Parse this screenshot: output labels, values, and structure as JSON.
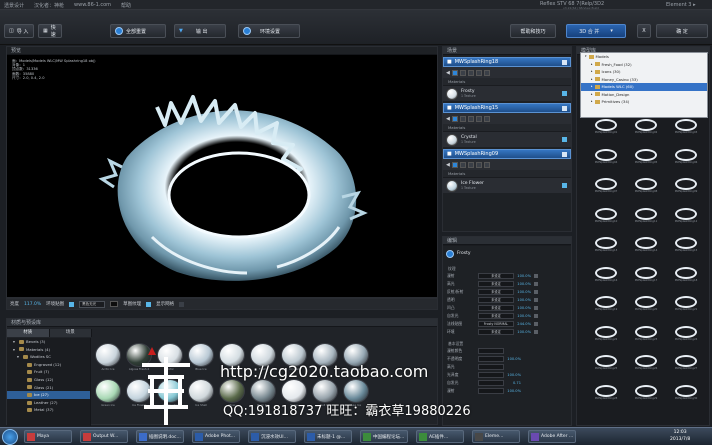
{
  "titlebar": {
    "menus": [
      "透景设计",
      "汉化者：神枪",
      "帮助"
    ],
    "url": "www.86-1.com",
    "window_title": "Reflex STV 68 7(Relp/3D2",
    "window_version": "v3.22(64) SB-View Build",
    "app_label": "Element",
    "app_version": "3 ▸"
  },
  "toolbar": {
    "import": "导 入",
    "quick": "快速",
    "reset_all": "全部重置",
    "export": "输 出",
    "env_settings": "环境设置",
    "help": "帮助和技巧",
    "combine_3d": "3D 合 并",
    "close": "X",
    "confirm": "确  定"
  },
  "viewport": {
    "title": "预览",
    "info": [
      "面：Models/Models WLC/MW Splashring18 obj)",
      "对象：1",
      "顶点数：31336",
      "面数：35880",
      "尺寸：2.0, 0.4, 2.0"
    ]
  },
  "viewport_bar": {
    "brightness_label": "亮度",
    "brightness_value": "117.0%",
    "env_map_label": "环境贴图",
    "env_map_value": "黑色无光",
    "draft_label": "草图纹理",
    "grid_label": "显示网格"
  },
  "library": {
    "title": "材质与预设库",
    "tabs": [
      "材质",
      "场景"
    ],
    "tree": [
      {
        "label": "Bevels (3)",
        "indent": 1,
        "selected": false
      },
      {
        "label": "Materials (4)",
        "indent": 1,
        "selected": false
      },
      {
        "label": "Wodiles SC",
        "indent": 2,
        "selected": false
      },
      {
        "label": "Engraved (12)",
        "indent": 3,
        "selected": false
      },
      {
        "label": "Fruit (7)",
        "indent": 3,
        "selected": false
      },
      {
        "label": "Glass (12)",
        "indent": 3,
        "selected": false
      },
      {
        "label": "Glass (21)",
        "indent": 3,
        "selected": false
      },
      {
        "label": "Ice (27)",
        "indent": 3,
        "selected": true
      },
      {
        "label": "Leather (27)",
        "indent": 3,
        "selected": false
      },
      {
        "label": "Metal (37)",
        "indent": 3,
        "selected": false
      }
    ],
    "thumbs": [
      {
        "label": "Arctic Ice",
        "color": "#c9d4dc"
      },
      {
        "label": "Algoas Fresh 2",
        "color": "#2f3d35"
      },
      {
        "label": "Arctic",
        "color": "#d8dfe4"
      },
      {
        "label": "Blue Ice",
        "color": "#b8c8d4"
      },
      {
        "label": "Frost",
        "color": "#d4dde2"
      },
      {
        "label": "Frosty",
        "color": "#cfd8de"
      },
      {
        "label": "Crystal",
        "color": "#bcc8d0"
      },
      {
        "label": "Cube",
        "color": "#a8b6c0"
      },
      {
        "label": "Glacier",
        "color": "#96a8b4"
      },
      {
        "label": "Green Ice",
        "color": "#a8d8b4"
      },
      {
        "label": "Ice Flower",
        "color": "#c4d4de"
      },
      {
        "label": "Ice Crystal",
        "color": "#86c8d4"
      },
      {
        "label": "Ice Shell",
        "color": "#d0d8dc"
      },
      {
        "label": "Moss",
        "color": "#5a6a4a"
      },
      {
        "label": "Rock Ice",
        "color": "#7a8a92"
      },
      {
        "label": "Snow",
        "color": "#e4e8ec"
      },
      {
        "label": "Dull Ice",
        "color": "#98a4ac"
      },
      {
        "label": "Sea Ice",
        "color": "#6a8a9a"
      }
    ]
  },
  "scene": {
    "title": "场景",
    "objects": [
      {
        "name": "MWSplashRing18",
        "material": "Frosty",
        "mat_sub": "1 Texture",
        "mat_color": "#d6dfe6"
      },
      {
        "name": "MWSplashRing15",
        "material": "Crystal",
        "mat_sub": "1 Texture",
        "mat_color": "#c8d4dc"
      },
      {
        "name": "MWSplashRing09",
        "material": "Ice Flower",
        "mat_sub": "1 Texture",
        "mat_color": "#bcd0dc"
      }
    ],
    "materials_label": "Materials"
  },
  "material_panel": {
    "title": "编辑",
    "name": "Frosty",
    "texture_section": "纹理",
    "rows": [
      {
        "label": "漫射",
        "value": "未设定",
        "num": "100.0%"
      },
      {
        "label": "高光",
        "value": "未设定",
        "num": "100.0%"
      },
      {
        "label": "反射/折射",
        "value": "未设定",
        "num": "100.0%"
      },
      {
        "label": "透明",
        "value": "未设定",
        "num": "100.0%"
      },
      {
        "label": "凹凸",
        "value": "未设定",
        "num": "100.0%"
      },
      {
        "label": "自发光",
        "value": "未设定",
        "num": "100.0%"
      },
      {
        "label": "法线贴图",
        "value": "Frosty NORMAL",
        "num": "244.0%"
      },
      {
        "label": "环境",
        "value": "未设定",
        "num": "100.0%"
      }
    ],
    "basic_section": "基本设置",
    "basic_rows": [
      {
        "label": "漫射颜色",
        "num": ""
      },
      {
        "label": "不透明度",
        "num": "100.0%"
      },
      {
        "label": "高光",
        "num": ""
      },
      {
        "label": "光泽度",
        "num": "100.0%"
      },
      {
        "label": "自发光",
        "num": "0.71"
      },
      {
        "label": "漫射",
        "num": "100.0%"
      }
    ]
  },
  "right_panel": {
    "title": "模型库",
    "popup": [
      {
        "label": "Models",
        "indent": 0,
        "selected": false
      },
      {
        "label": "Fresh_Food (32)",
        "indent": 1,
        "selected": false
      },
      {
        "label": "Icons (30)",
        "indent": 1,
        "selected": false
      },
      {
        "label": "Money_Casino (33)",
        "indent": 1,
        "selected": false
      },
      {
        "label": "Models WLC (60)",
        "indent": 1,
        "selected": true
      },
      {
        "label": "Motion_Design",
        "indent": 1,
        "selected": false
      },
      {
        "label": "Primitives (34)",
        "indent": 1,
        "selected": false
      }
    ],
    "rings": [
      "MWSplashRing01",
      "MWSplashRing02",
      "MWSplashRing03",
      "MWSplashRing04",
      "MWSplashRing05",
      "MWSplashRing06",
      "MWSplashRing07",
      "MWSplashRing08",
      "MWSplashRing09",
      "MWSplashRing10",
      "MWSplashRing11",
      "MWSplashRing12",
      "MWSplashRing13",
      "MWSplashRing14",
      "MWSplashRing15",
      "MWSplashRing16",
      "MWSplashRing17",
      "MWSplashRing18",
      "MWSplashRing19",
      "MWSplashRing20",
      "MWSplashRing21",
      "MWSplashRing22",
      "MWSplashRing23",
      "MWSplashRing24",
      "MWSplashRing25",
      "MWSplashRing26",
      "MWSplashRing27",
      "MWSplashRing28",
      "MWSplashRing29",
      "MWSplashRing30"
    ]
  },
  "watermark": {
    "url": "http://cg2020.taobao.com",
    "qq": "QQ:191818737 旺旺：霸衣草19880226"
  },
  "taskbar": {
    "items": [
      {
        "label": "Maya",
        "color": "#c83c3c"
      },
      {
        "label": "Output W...",
        "color": "#c83c3c"
      },
      {
        "label": "插图说明.doc...",
        "color": "#3c6cc8"
      },
      {
        "label": "Adobe Phot...",
        "color": "#2c5ca8"
      },
      {
        "label": "沉浸水效UI...",
        "color": "#2c5ca8"
      },
      {
        "label": "未标题-1 @...",
        "color": "#2c5ca8"
      },
      {
        "label": "中国编程论坛...",
        "color": "#3c8c3c"
      },
      {
        "label": "AE插件...",
        "color": "#3c8c3c"
      },
      {
        "label": "Eleme...",
        "color": "#484848"
      },
      {
        "label": "Adobe After ...",
        "color": "#6a4ab0"
      }
    ],
    "time": "12:03",
    "date": "2013/7/8"
  }
}
